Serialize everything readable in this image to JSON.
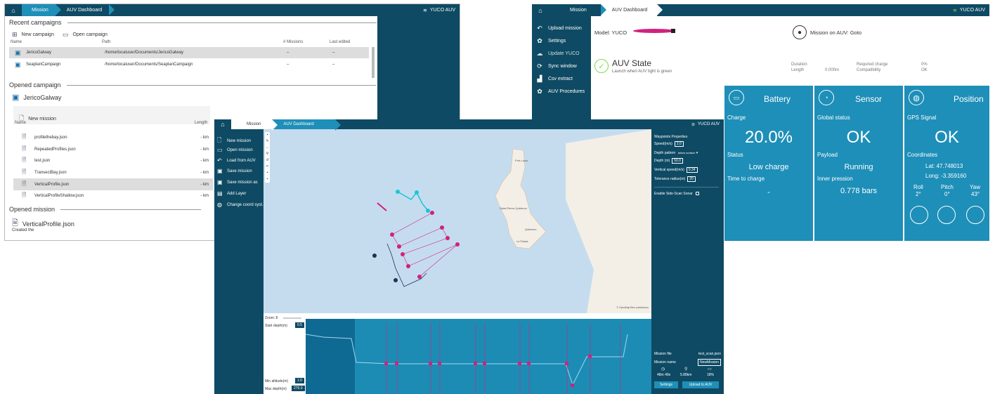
{
  "common": {
    "mission_tab": "Mission",
    "dashboard_tab": "AUV Dashboard",
    "vehicle": "YUCO AUV"
  },
  "w1": {
    "recent_title": "Recent campaigns",
    "new_campaign": "New campaign",
    "open_campaign": "Open campaign",
    "cols": [
      "Name",
      "Path",
      "# Missions",
      "Last edited"
    ],
    "campaigns": [
      {
        "name": "JericoGalway",
        "path": "/home/localuser/Documents/JericoGalway",
        "missions": "–",
        "edited": "–"
      },
      {
        "name": "SeaplanCampaign",
        "path": "/home/localuser/Documents/SeaplanCampaign",
        "missions": "–",
        "edited": "–"
      }
    ],
    "opened_campaign_title": "Opened campaign",
    "campaign_name": "JericoGalway",
    "new_mission": "New mission",
    "mcols": [
      "Name",
      "Length"
    ],
    "missions": [
      {
        "name": "profilethebay.json",
        "len": "- km"
      },
      {
        "name": "RepeatedProfiles.json",
        "len": "- km"
      },
      {
        "name": "test.json",
        "len": "- km"
      },
      {
        "name": "TransectBay.json",
        "len": "- km"
      },
      {
        "name": "VerticalProfile.json",
        "len": "- km"
      },
      {
        "name": "VerticalProfileShallow.json",
        "len": "- km"
      }
    ],
    "opened_mission_title": "Opened mission",
    "mission_name": "VerticalProfile.json",
    "created": "Created the"
  },
  "w2": {
    "nav": [
      "Upload mission",
      "Settings",
      "Update YUCO",
      "Sync window",
      "Csv extract",
      "AUV Procedures"
    ],
    "model_label": "Model: YUCO",
    "mission_label": "Mission on AUV: Goto",
    "state_title": "AUV State",
    "state_sub": "Launch when AUV light is green",
    "duration_l": "Duration",
    "length_l": "Length",
    "length_v": "0.000m",
    "reqcharge_l": "Required charge",
    "reqcharge_v": "0%",
    "compat_l": "Compatibility",
    "compat_v": "OK",
    "battery": {
      "title": "Battery",
      "charge_l": "Charge",
      "charge": "20.0%",
      "status_l": "Status",
      "status": "Low charge",
      "ttc_l": "Time to charge",
      "ttc": "-"
    },
    "sensor": {
      "title": "Sensor",
      "global_l": "Global status",
      "global": "OK",
      "payload_l": "Payload",
      "payload": "Running",
      "inner_l": "Inner pression",
      "inner": "0.778 bars"
    },
    "position": {
      "title": "Position",
      "gps_l": "GPS Signal",
      "gps": "OK",
      "coord_l": "Coordinates",
      "lat": "Lat: 47.748013",
      "long": "Long: -3.359160",
      "roll_l": "Roll",
      "roll": "2°",
      "pitch_l": "Pitch",
      "pitch": "0°",
      "yaw_l": "Yaw",
      "yaw": "43°"
    }
  },
  "w3": {
    "menu": [
      "New mission",
      "Open mission",
      "Load from AUV",
      "Save mission",
      "Save mission as",
      "Add Layer",
      "Change coord syst."
    ],
    "wp_title": "Waypoints Properties",
    "speed_l": "Speed(m/s)",
    "speed": "2.0",
    "depthpat_l": "Depth pattern",
    "depthpat": "below surface",
    "depth_l": "Depth (m)",
    "depth": "50.0",
    "vspeed_l": "Vertical speed(m/s)",
    "vspeed": "0.34",
    "tol_l": "Tolerance radius(m)",
    "tol": "20",
    "sss_l": "Enable Side-Scan Sonar",
    "zoom_l": "Zoom: 8",
    "start_l": "Start depth(m)",
    "start": "0.5",
    "minalt_l": "Min altitude(m)",
    "minalt": "1.0",
    "maxd_l": "Max depth(m)",
    "maxd": "275.0",
    "mfile_l": "Mission file",
    "mfile": "test_scan.json",
    "mname_l": "Mission name",
    "mname": "NewMission",
    "dur": "48m 49s",
    "dist": "5.88km",
    "batt": "18%",
    "settings": "Settings",
    "upload": "Upload to AUV",
    "map_labels": [
      "Port-Louis",
      "Saint-Pierre-Quiberon",
      "Quiberon",
      "Le Palais"
    ],
    "credit": "© OpenMapTiles contributors"
  }
}
